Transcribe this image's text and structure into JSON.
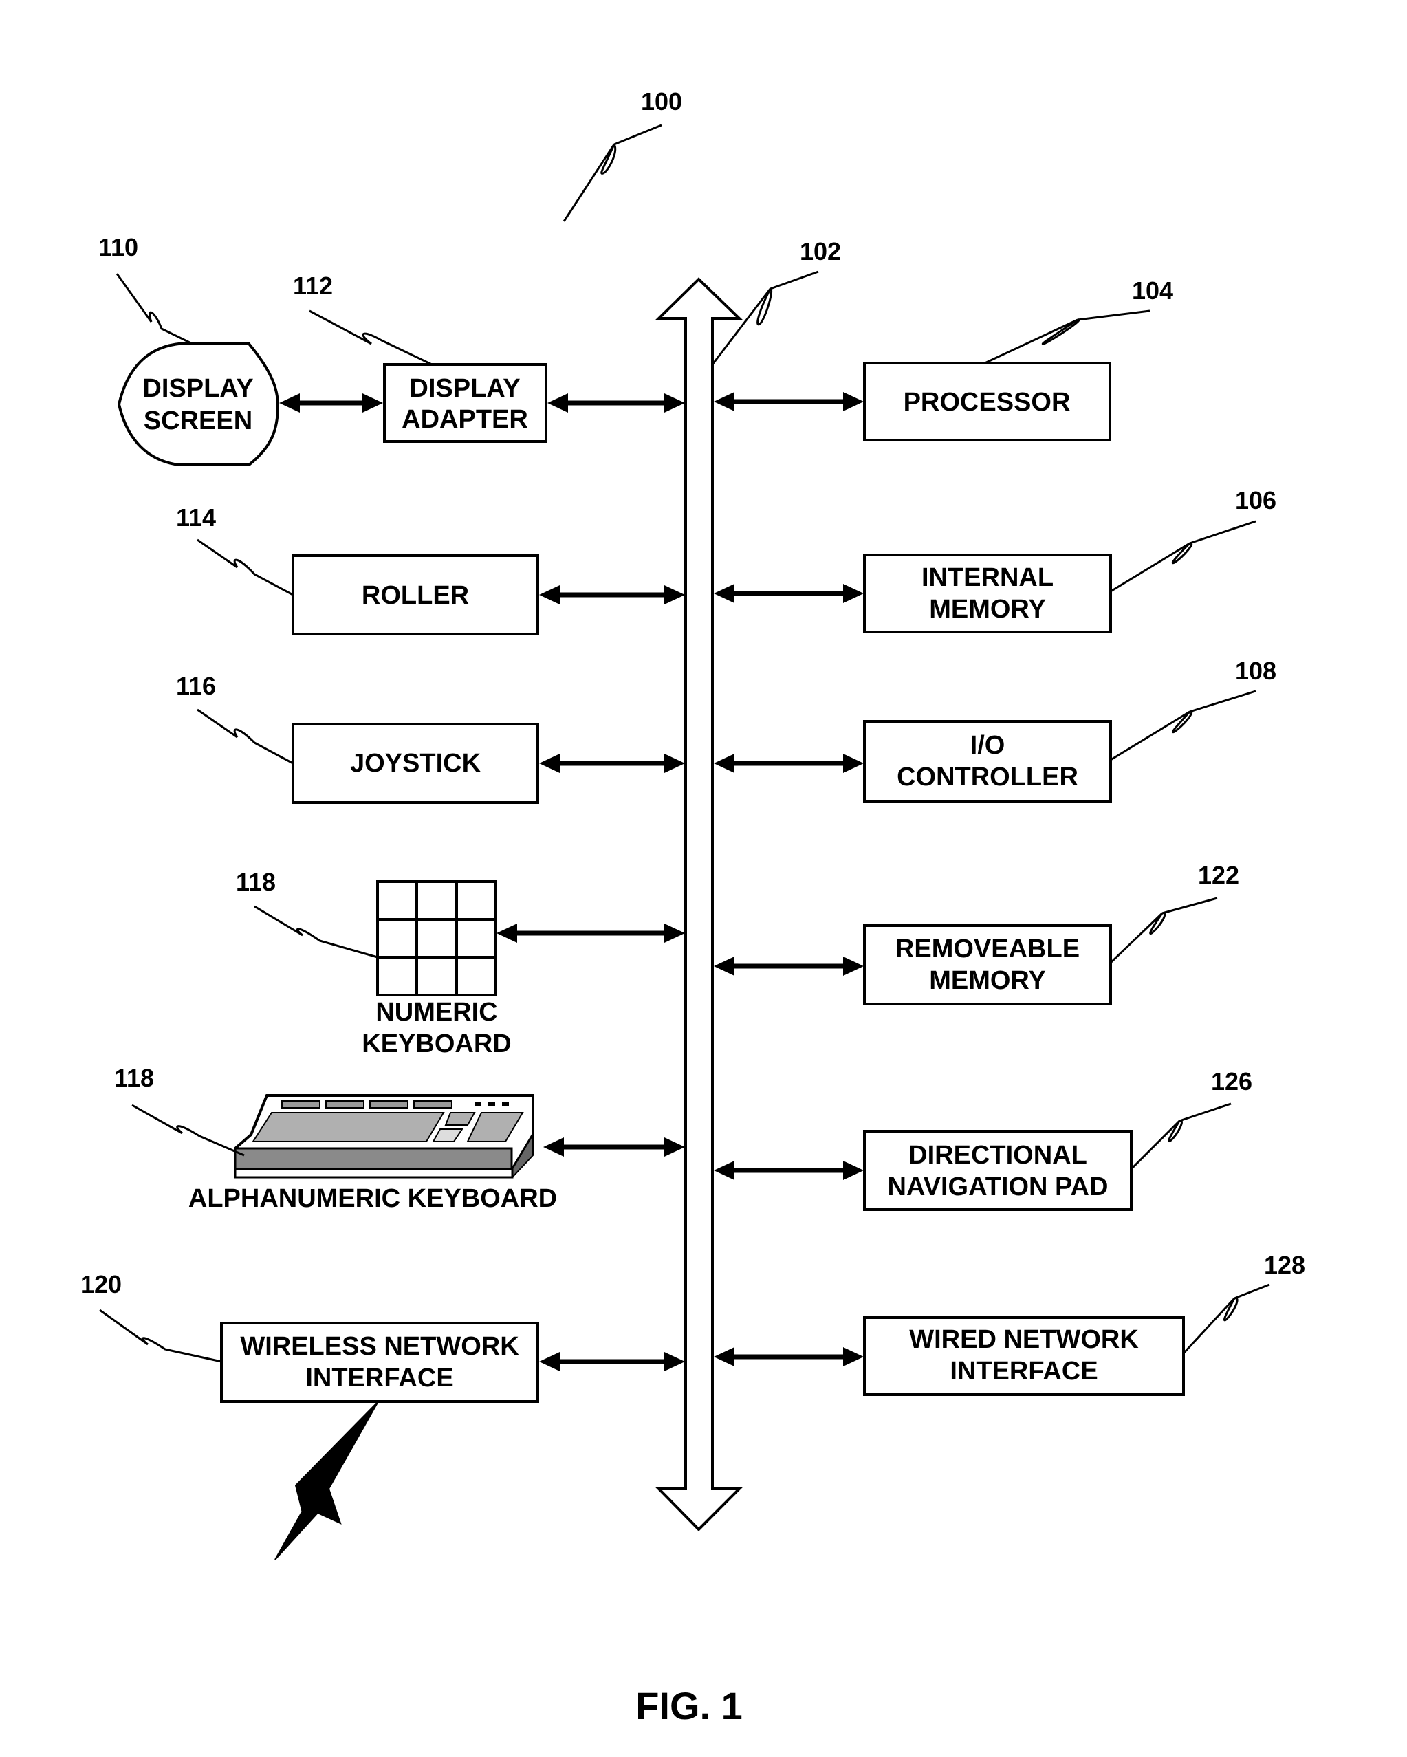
{
  "figure": {
    "caption": "FIG. 1",
    "system_ref": "100",
    "bus_ref": "102"
  },
  "components": {
    "display_screen": {
      "ref": "110",
      "lines": [
        "DISPLAY",
        "SCREEN"
      ]
    },
    "display_adapter": {
      "ref": "112",
      "lines": [
        "DISPLAY",
        "ADAPTER"
      ]
    },
    "processor": {
      "ref": "104",
      "lines": [
        "PROCESSOR"
      ]
    },
    "roller": {
      "ref": "114",
      "lines": [
        "ROLLER"
      ]
    },
    "internal_memory": {
      "ref": "106",
      "lines": [
        "INTERNAL",
        "MEMORY"
      ]
    },
    "joystick": {
      "ref": "116",
      "lines": [
        "JOYSTICK"
      ]
    },
    "io_controller": {
      "ref": "108",
      "lines": [
        "I/O",
        "CONTROLLER"
      ]
    },
    "numeric_keyboard": {
      "ref": "118",
      "lines": [
        "NUMERIC",
        "KEYBOARD"
      ]
    },
    "removeable_memory": {
      "ref": "122",
      "lines": [
        "REMOVEABLE",
        "MEMORY"
      ]
    },
    "alphanumeric_keyboard": {
      "ref": "118",
      "lines": [
        "ALPHANUMERIC KEYBOARD"
      ]
    },
    "directional_navigation_pad": {
      "ref": "126",
      "lines": [
        "DIRECTIONAL",
        "NAVIGATION PAD"
      ]
    },
    "wireless_network_interface": {
      "ref": "120",
      "lines": [
        "WIRELESS NETWORK",
        "INTERFACE"
      ]
    },
    "wired_network_interface": {
      "ref": "128",
      "lines": [
        "WIRED NETWORK",
        "INTERFACE"
      ]
    }
  },
  "icons": {
    "bus": "double-headed-arrow-icon",
    "wireless": "lightning-bolt-icon",
    "numeric_keyboard": "keypad-grid-icon",
    "alphanumeric_keyboard": "keyboard-icon"
  }
}
